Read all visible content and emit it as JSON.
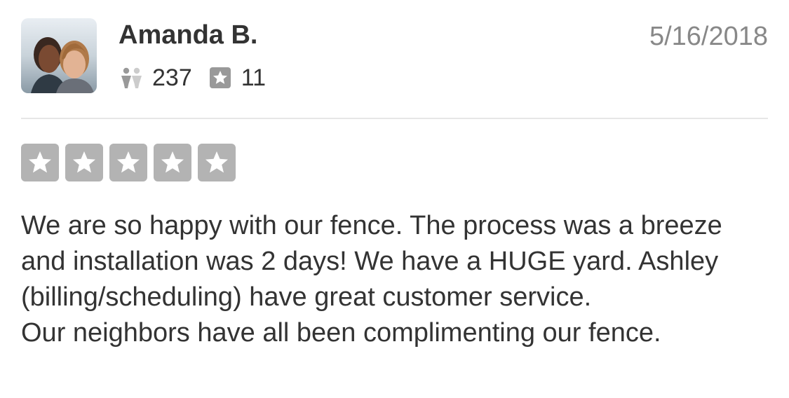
{
  "user": {
    "name": "Amanda B.",
    "avatar_icon": "user-photo-avatar",
    "friend_count": "237",
    "review_count": "11"
  },
  "review": {
    "date": "5/16/2018",
    "rating": 5,
    "rating_max": 5,
    "star_color": "#b3b3b3",
    "paragraphs": [
      "We are so happy with our fence. The process was a breeze and installation was 2 days! We have a HUGE yard. Ashley (billing/scheduling) have great customer service.",
      "Our neighbors have all been complimenting our fence."
    ]
  },
  "icons": {
    "friends": "friends-icon",
    "reviews": "review-star-icon",
    "rating_star": "star-icon"
  }
}
